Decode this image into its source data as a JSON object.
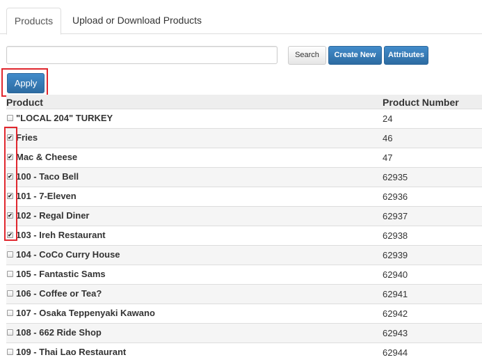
{
  "tabs": [
    {
      "label": "Products",
      "active": true
    },
    {
      "label": "Upload or Download Products",
      "active": false
    }
  ],
  "search": {
    "value": "",
    "placeholder": ""
  },
  "toolbar": {
    "search_label": "Search",
    "create_label": "Create New",
    "attributes_label": "Attributes",
    "apply_label": "Apply"
  },
  "table": {
    "headers": [
      "Product",
      "Product Number"
    ],
    "rows": [
      {
        "name": "\"LOCAL 204\" TURKEY",
        "number": "24",
        "checked": false
      },
      {
        "name": "Fries",
        "number": "46",
        "checked": true
      },
      {
        "name": "Mac & Cheese",
        "number": "47",
        "checked": true
      },
      {
        "name": "100 - Taco Bell",
        "number": "62935",
        "checked": true
      },
      {
        "name": "101 - 7-Eleven",
        "number": "62936",
        "checked": true
      },
      {
        "name": "102 - Regal Diner",
        "number": "62937",
        "checked": true
      },
      {
        "name": "103 - Ireh Restaurant",
        "number": "62938",
        "checked": true
      },
      {
        "name": "104 - CoCo Curry House",
        "number": "62939",
        "checked": false
      },
      {
        "name": "105 - Fantastic Sams",
        "number": "62940",
        "checked": false
      },
      {
        "name": "106 - Coffee or Tea?",
        "number": "62941",
        "checked": false
      },
      {
        "name": "107 - Osaka Teppenyaki Kawano",
        "number": "62942",
        "checked": false
      },
      {
        "name": "108 - 662 Ride Shop",
        "number": "62943",
        "checked": false
      },
      {
        "name": "109 - Thai Lao Restaurant",
        "number": "62944",
        "checked": false
      }
    ]
  },
  "colors": {
    "primary": "#337ab7",
    "highlight": "#e0262d",
    "row_alt": "#f5f5f5",
    "header_bg": "#eeeeee"
  }
}
